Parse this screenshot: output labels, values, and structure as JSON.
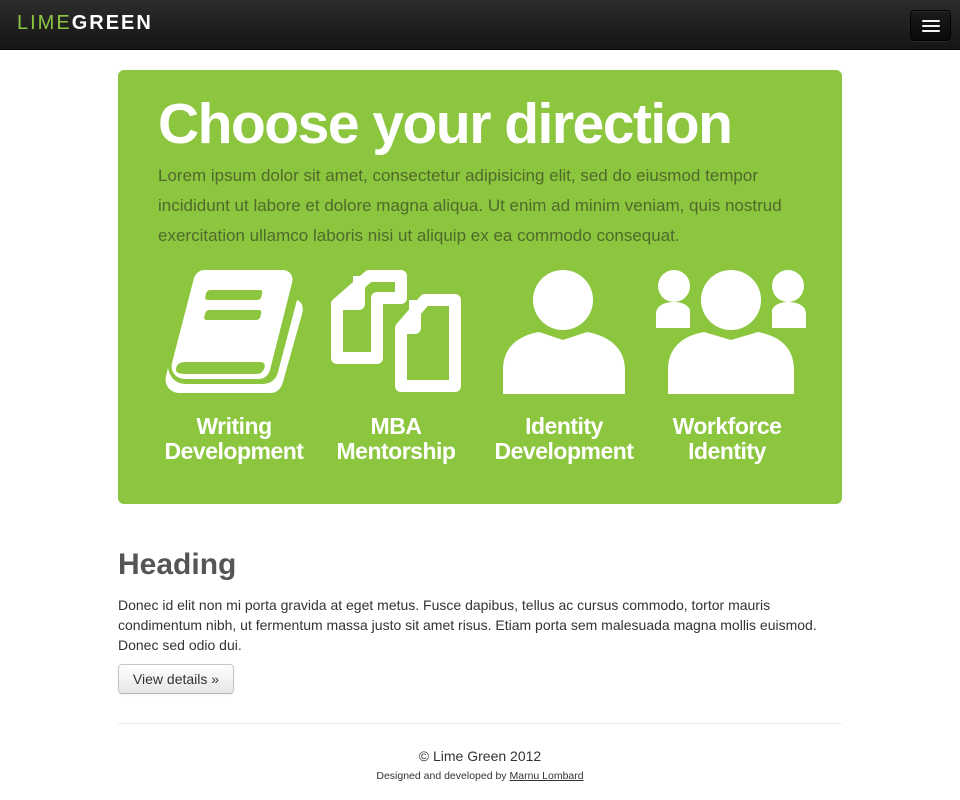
{
  "navbar": {
    "brand_part1": "LIME",
    "brand_part2": "GREEN",
    "menu_icon": "hamburger-menu-icon",
    "background": "#1b1b1b",
    "brand_accent": "#8cc63f"
  },
  "hero": {
    "title": "Choose your direction",
    "text": "Lorem ipsum dolor sit amet, consectetur adipisicing elit, sed do eiusmod tempor incididunt ut labore et dolore magna aliqua. Ut enim ad minim veniam, quis nostrud exercitation ullamco laboris nisi ut aliquip ex ea commodo consequat.",
    "background": "#8cc63f",
    "tiles": [
      {
        "icon": "book-icon",
        "line1": "Writing",
        "line2": "Development"
      },
      {
        "icon": "documents-icon",
        "line1": "MBA",
        "line2": "Mentorship"
      },
      {
        "icon": "person-icon",
        "line1": "Identity",
        "line2": "Development"
      },
      {
        "icon": "group-icon",
        "line1": "Workforce",
        "line2": "Identity"
      }
    ]
  },
  "content": {
    "heading": "Heading",
    "text": "Donec id elit non mi porta gravida at eget metus. Fusce dapibus, tellus ac cursus commodo, tortor mauris condimentum nibh, ut fermentum massa justo sit amet risus. Etiam porta sem malesuada magna mollis euismod. Donec sed odio dui.",
    "button_label": "View details »"
  },
  "footer": {
    "copyright": "© Lime Green 2012",
    "credit_prefix": "Designed and developed by ",
    "credit_link": "Marnu Lombard"
  }
}
